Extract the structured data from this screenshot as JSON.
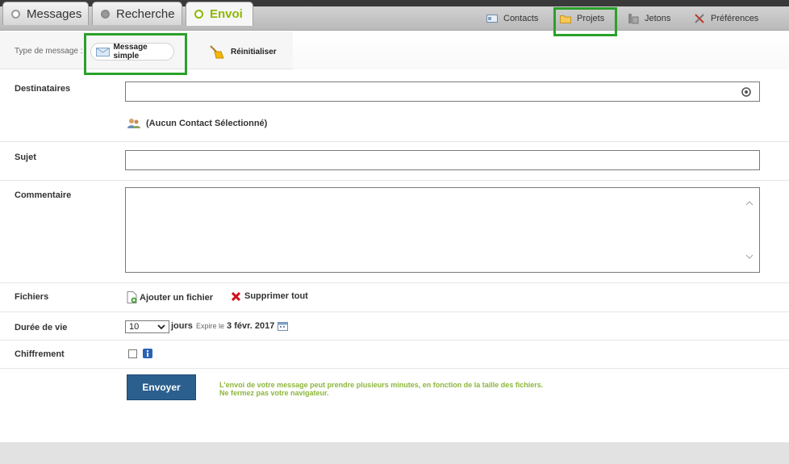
{
  "tabs": [
    {
      "label": "Messages",
      "icon": "circle-icon"
    },
    {
      "label": "Recherche",
      "icon": "filled-circle-icon"
    },
    {
      "label": "Envoi",
      "icon": "circle-icon",
      "active": true
    }
  ],
  "toolbar": [
    {
      "label": "Contacts",
      "icon": "contacts-icon"
    },
    {
      "label": "Projets",
      "icon": "folder-icon"
    },
    {
      "label": "Jetons",
      "icon": "tokens-icon"
    },
    {
      "label": "Préférences",
      "icon": "tools-icon"
    }
  ],
  "message_type": {
    "label": "Type de message :",
    "selected": "Message simple",
    "reset": "Réinitialiser"
  },
  "form": {
    "recipients_label": "Destinataires",
    "no_contact": "(Aucun Contact Sélectionné)",
    "subject_label": "Sujet",
    "comment_label": "Commentaire",
    "files_label": "Fichiers",
    "add_file": "Ajouter un fichier",
    "delete_all": "Supprimer tout",
    "lifetime_label": "Durée de vie",
    "lifetime_value": "10",
    "lifetime_unit": "jours",
    "expires_prefix": "Expire le",
    "expires_date": "3 févr. 2017",
    "encryption_label": "Chiffrement",
    "send_button": "Envoyer",
    "note_line1": "L'envoi de votre message peut prendre plusieurs minutes, en fonction de la taille des fichiers.",
    "note_line2": "Ne fermez pas votre navigateur."
  },
  "colors": {
    "accent_green": "#8cb800",
    "highlight_box": "#2aa12a",
    "send_button_bg": "#2b5f8e",
    "note_text": "#8db63a"
  }
}
